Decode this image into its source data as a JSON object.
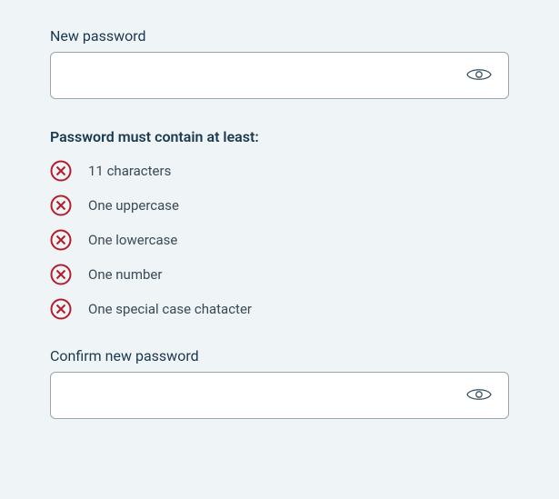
{
  "newPassword": {
    "label": "New password",
    "value": ""
  },
  "confirmPassword": {
    "label": "Confirm new password",
    "value": ""
  },
  "requirements": {
    "heading": "Password must contain at least:",
    "items": [
      {
        "label": "11 characters",
        "met": false
      },
      {
        "label": "One uppercase",
        "met": false
      },
      {
        "label": "One lowercase",
        "met": false
      },
      {
        "label": "One number",
        "met": false
      },
      {
        "label": "One special case chatacter",
        "met": false
      }
    ]
  },
  "colors": {
    "failIcon": "#b71c2b",
    "text": "#1b3850"
  }
}
